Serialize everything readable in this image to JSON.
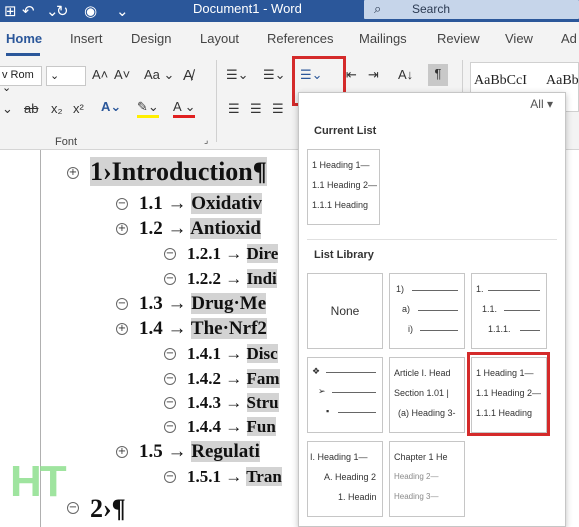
{
  "titlebar": {
    "doc_title": "Document1 - Word",
    "search_label": "Search"
  },
  "tabs": [
    "Home",
    "Insert",
    "Design",
    "Layout",
    "References",
    "Mailings",
    "Review",
    "View",
    "Ad"
  ],
  "ribbon": {
    "font_name": "v Rom",
    "font_group_label": "Font",
    "style_previews": [
      "AaBbCcI",
      "AaBb"
    ]
  },
  "dropdown": {
    "filter": "All",
    "current_list_heading": "Current List",
    "current_list_lines": [
      "1 Heading 1—",
      "1.1 Heading 2—",
      "1.1.1 Heading"
    ],
    "list_library_heading": "List Library",
    "none_label": "None",
    "lib2": [
      "1)",
      "a)",
      "i)"
    ],
    "lib3": [
      "1.",
      "1.1.",
      "1.1.1."
    ],
    "lib5": [
      "Article I. Head",
      "Section 1.01 |",
      "(a) Heading 3-"
    ],
    "lib6": [
      "1 Heading 1—",
      "1.1 Heading 2—",
      "1.1.1 Heading"
    ],
    "lib7": [
      "I. Heading 1—",
      "A. Heading 2",
      "1. Headin"
    ],
    "lib8": [
      "Chapter 1 He",
      "Heading 2—",
      "Heading 3—"
    ]
  },
  "document": {
    "h1": "1›Introduction¶",
    "items": [
      {
        "num": "1.1",
        "text": "Oxidativ"
      },
      {
        "num": "1.2",
        "text": "Antioxid"
      },
      {
        "num": "1.2.1",
        "text": "Dire"
      },
      {
        "num": "1.2.2",
        "text": "Indi"
      },
      {
        "num": "1.3",
        "text": "Drug·Me"
      },
      {
        "num": "1.4",
        "text": "The·Nrf2"
      },
      {
        "num": "1.4.1",
        "text": "Disc"
      },
      {
        "num": "1.4.2",
        "text": "Fam"
      },
      {
        "num": "1.4.3",
        "text": "Stru"
      },
      {
        "num": "1.4.4",
        "text": "Fun"
      },
      {
        "num": "1.5",
        "text": "Regulati"
      },
      {
        "num": "1.5.1",
        "text": "Tran"
      }
    ],
    "h2": "2›¶",
    "watermark": "HT"
  }
}
